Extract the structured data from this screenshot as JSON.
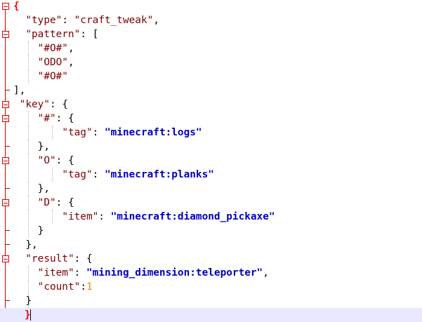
{
  "editor": {
    "lines": [
      [
        {
          "text": "{",
          "kind": "brace-hl"
        }
      ],
      [
        {
          "text": "  ",
          "kind": "op"
        },
        {
          "text": "\"type\"",
          "kind": "key"
        },
        {
          "text": ": ",
          "kind": "op"
        },
        {
          "text": "\"craft_tweak\"",
          "kind": "str"
        },
        {
          "text": ",",
          "kind": "op"
        }
      ],
      [
        {
          "text": "  ",
          "kind": "op"
        },
        {
          "text": "\"pattern\"",
          "kind": "key"
        },
        {
          "text": ": [",
          "kind": "op"
        }
      ],
      [
        {
          "text": "    ",
          "kind": "op"
        },
        {
          "text": "\"#O#\"",
          "kind": "str"
        },
        {
          "text": ",",
          "kind": "op"
        }
      ],
      [
        {
          "text": "    ",
          "kind": "op"
        },
        {
          "text": "\"ODO\"",
          "kind": "str"
        },
        {
          "text": ",",
          "kind": "op"
        }
      ],
      [
        {
          "text": "    ",
          "kind": "op"
        },
        {
          "text": "\"#O#\"",
          "kind": "str"
        }
      ],
      [
        {
          "text": "],",
          "kind": "op"
        }
      ],
      [
        {
          "text": " ",
          "kind": "op"
        },
        {
          "text": "\"key\"",
          "kind": "key"
        },
        {
          "text": ": {",
          "kind": "op"
        }
      ],
      [
        {
          "text": "    ",
          "kind": "op"
        },
        {
          "text": "\"#\"",
          "kind": "key"
        },
        {
          "text": ": {",
          "kind": "op"
        }
      ],
      [
        {
          "text": "        ",
          "kind": "op"
        },
        {
          "text": "\"tag\"",
          "kind": "key"
        },
        {
          "text": ": ",
          "kind": "op"
        },
        {
          "text": "\"minecraft:logs\"",
          "kind": "val"
        }
      ],
      [
        {
          "text": "    },",
          "kind": "op"
        }
      ],
      [
        {
          "text": "    ",
          "kind": "op"
        },
        {
          "text": "\"O\"",
          "kind": "key"
        },
        {
          "text": ": {",
          "kind": "op"
        }
      ],
      [
        {
          "text": "        ",
          "kind": "op"
        },
        {
          "text": "\"tag\"",
          "kind": "key"
        },
        {
          "text": ": ",
          "kind": "op"
        },
        {
          "text": "\"minecraft:planks\"",
          "kind": "val"
        }
      ],
      [
        {
          "text": "    },",
          "kind": "op"
        }
      ],
      [
        {
          "text": "    ",
          "kind": "op"
        },
        {
          "text": "\"D\"",
          "kind": "key"
        },
        {
          "text": ": {",
          "kind": "op"
        }
      ],
      [
        {
          "text": "        ",
          "kind": "op"
        },
        {
          "text": "\"item\"",
          "kind": "key"
        },
        {
          "text": ": ",
          "kind": "op"
        },
        {
          "text": "\"minecraft:diamond_pickaxe\"",
          "kind": "val"
        }
      ],
      [
        {
          "text": "    }",
          "kind": "op"
        }
      ],
      [
        {
          "text": "  },",
          "kind": "op"
        }
      ],
      [
        {
          "text": "  ",
          "kind": "op"
        },
        {
          "text": "\"result\"",
          "kind": "key"
        },
        {
          "text": ": {",
          "kind": "op"
        }
      ],
      [
        {
          "text": "    ",
          "kind": "op"
        },
        {
          "text": "\"item\"",
          "kind": "key"
        },
        {
          "text": ": ",
          "kind": "op"
        },
        {
          "text": "\"mining_dimension:teleporter\"",
          "kind": "val"
        },
        {
          "text": ",",
          "kind": "op"
        }
      ],
      [
        {
          "text": "    ",
          "kind": "op"
        },
        {
          "text": "\"count\"",
          "kind": "key"
        },
        {
          "text": ":",
          "kind": "op"
        },
        {
          "text": "1",
          "kind": "num"
        }
      ],
      [
        {
          "text": "  }",
          "kind": "op"
        }
      ],
      [
        {
          "text": "}",
          "kind": "brace-hl"
        }
      ]
    ],
    "current_line": 22,
    "colors": {
      "key": "#7f0000",
      "string": "#7f0000",
      "value": "#0000c0",
      "number": "#ff8000",
      "fold_marker": "#cc0000",
      "current_line_bg": "#e8e8ff"
    }
  }
}
